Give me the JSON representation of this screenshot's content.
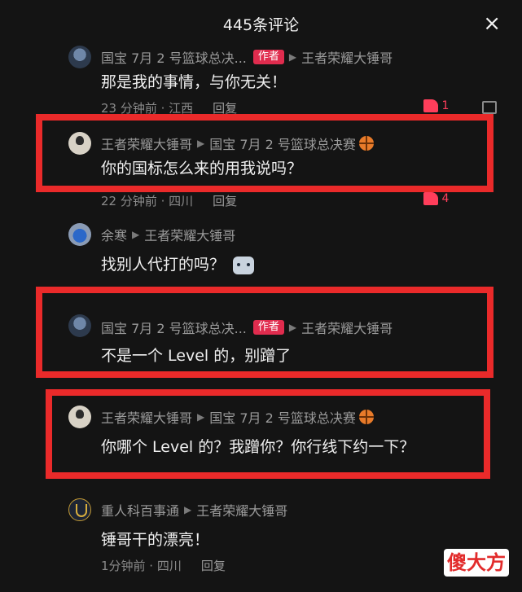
{
  "header": {
    "title": "445条评论",
    "close_glyph": "×"
  },
  "comments": [
    {
      "user": "国宝 7月 2 号篮球总决...",
      "badge": "作者",
      "reply_to": "王者荣耀大锤哥",
      "text": "那是我的事情，与你无关！",
      "time": "23 分钟前 · 江西",
      "reply": "回复",
      "likes": "1"
    },
    {
      "user": "王者荣耀大锤哥",
      "reply_to": "国宝 7月 2 号篮球总决赛",
      "text": "你的国标怎么来的用我说吗？",
      "time": "22 分钟前 · 四川",
      "reply": "回复",
      "likes": "4"
    },
    {
      "user": "余寒",
      "reply_to": "王者荣耀大锤哥",
      "text": "找别人代打的吗？",
      "time": "",
      "reply": ""
    },
    {
      "user": "国宝 7月 2 号篮球总决...",
      "badge": "作者",
      "reply_to": "王者荣耀大锤哥",
      "text": "不是一个 Level 的，别蹭了",
      "time": "",
      "reply": ""
    },
    {
      "user": "王者荣耀大锤哥",
      "reply_to": "国宝 7月 2 号篮球总决赛",
      "text": "你哪个 Level 的？我蹭你？你行线下约一下？",
      "time": "",
      "reply": ""
    },
    {
      "user": "重人科百事通",
      "reply_to": "王者荣耀大锤哥",
      "text": "锤哥干的漂亮！",
      "time": "1分钟前 · 四川",
      "reply": "回复"
    }
  ],
  "watermark": "傻大方",
  "colors": {
    "highlight": "#ea2a2a",
    "badge": "#e02c4e",
    "like": "#ff3e5b"
  }
}
